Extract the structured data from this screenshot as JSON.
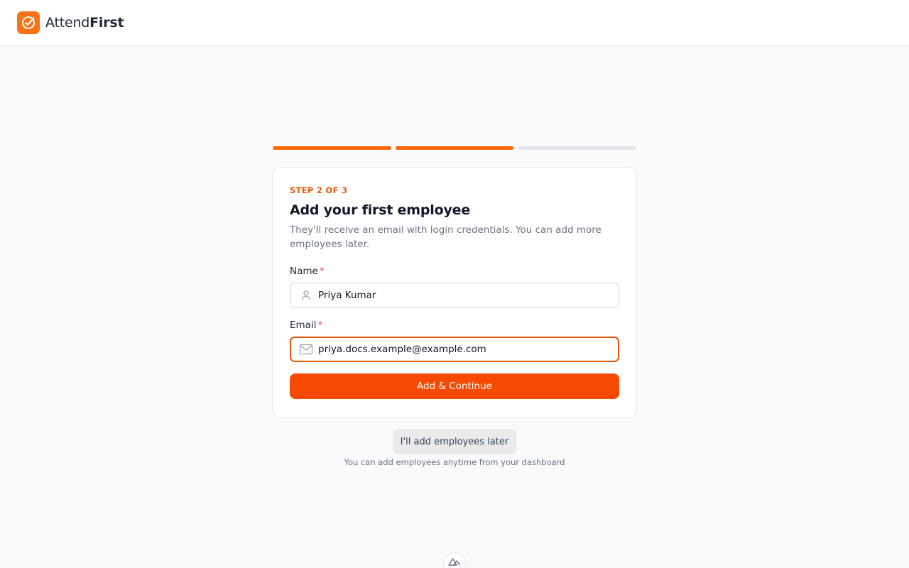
{
  "brand": {
    "name_regular": "Attend",
    "name_bold": "First",
    "logo_icon": "check-circle-icon",
    "accent_color": "#f97316"
  },
  "progress": {
    "total_steps": 3,
    "completed_steps": 2
  },
  "card": {
    "step_label": "STEP 2 OF 3",
    "title": "Add your first employee",
    "subtitle": "They'll receive an email with login credentials. You can add more employees later."
  },
  "form": {
    "name": {
      "label": "Name",
      "required_mark": "*",
      "value": "Priya Kumar",
      "icon": "user-icon"
    },
    "email": {
      "label": "Email",
      "required_mark": "*",
      "value": "priya.docs.example@example.com",
      "icon": "mail-icon"
    },
    "submit_label": "Add & Continue"
  },
  "skip": {
    "button_label": "I'll add employees later",
    "hint": "You can add employees anytime from your dashboard"
  },
  "footer": {
    "badge_icon": "mountain-logo-icon"
  }
}
